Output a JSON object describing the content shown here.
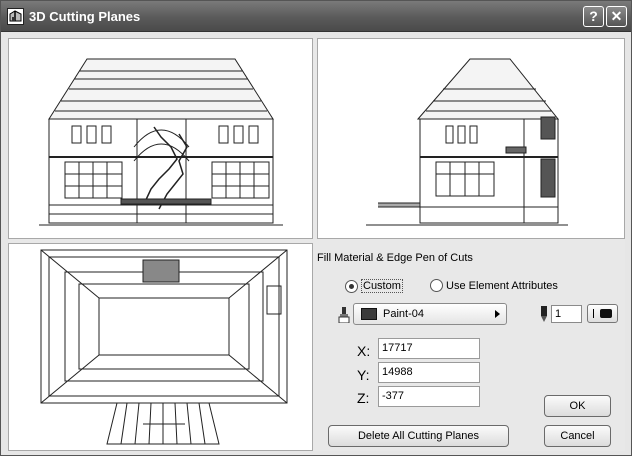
{
  "window": {
    "title": "3D Cutting Planes",
    "help_label": "?",
    "close_label": "✕"
  },
  "views": {
    "front_elevation": "house-front-section-icon",
    "side_elevation": "house-side-section-icon",
    "plan": "house-plan-section-icon"
  },
  "fill": {
    "section_label": "Fill Material & Edge Pen of Cuts",
    "custom_label": "Custom",
    "custom_selected": true,
    "element_attr_label": "Use Element Attributes",
    "element_attr_selected": false,
    "material_value": "Paint-04",
    "material_color": "#3a3a3a",
    "pen_value": "1",
    "pen_color": "#111111"
  },
  "coords": {
    "x_label": "X:",
    "x_value": "17717",
    "y_label": "Y:",
    "y_value": "14988",
    "z_label": "Z:",
    "z_value": "-377"
  },
  "buttons": {
    "ok_label": "OK",
    "cancel_label": "Cancel",
    "delete_label": "Delete All Cutting Planes"
  }
}
